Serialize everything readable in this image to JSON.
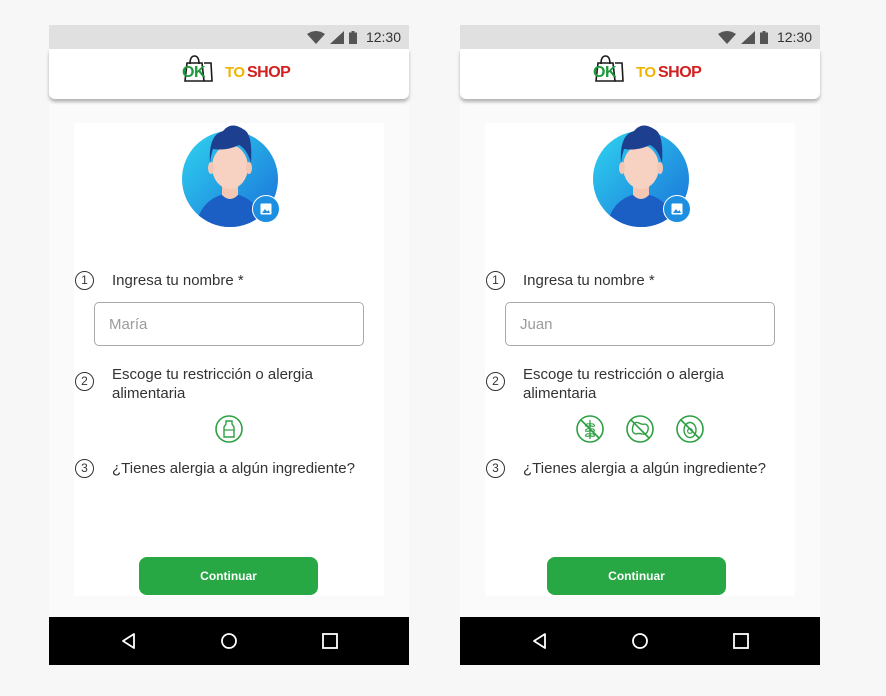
{
  "status_bar": {
    "time": "12:30"
  },
  "logo": {
    "ok": "OK",
    "to": "TO",
    "shop": "SHOP"
  },
  "colors": {
    "brand_green": "#28a745",
    "logo_green": "#1d9a3c",
    "logo_yellow": "#f0b400",
    "logo_red": "#d22020",
    "allergen_green": "#2ea043",
    "avatar_blue": "#1e8fe0"
  },
  "screens": [
    {
      "steps": [
        {
          "number": "1",
          "label": "Ingresa tu nombre *"
        },
        {
          "number": "2",
          "label": "Escoge tu restricción o alergia alimentaria"
        },
        {
          "number": "3",
          "label": "¿Tienes alergia a algún ingrediente?"
        }
      ],
      "name_input": {
        "placeholder": "María",
        "value": ""
      },
      "allergen_icons": [
        "milk-bottle-icon"
      ],
      "continue_label": "Continuar"
    },
    {
      "steps": [
        {
          "number": "1",
          "label": "Ingresa tu nombre *"
        },
        {
          "number": "2",
          "label": "Escoge tu restricción o alergia alimentaria"
        },
        {
          "number": "3",
          "label": "¿Tienes alergia a algún ingrediente?"
        }
      ],
      "name_input": {
        "placeholder": "Juan",
        "value": ""
      },
      "allergen_icons": [
        "gluten-free-icon",
        "no-peanut-icon",
        "no-egg-icon"
      ],
      "continue_label": "Continuar"
    }
  ]
}
